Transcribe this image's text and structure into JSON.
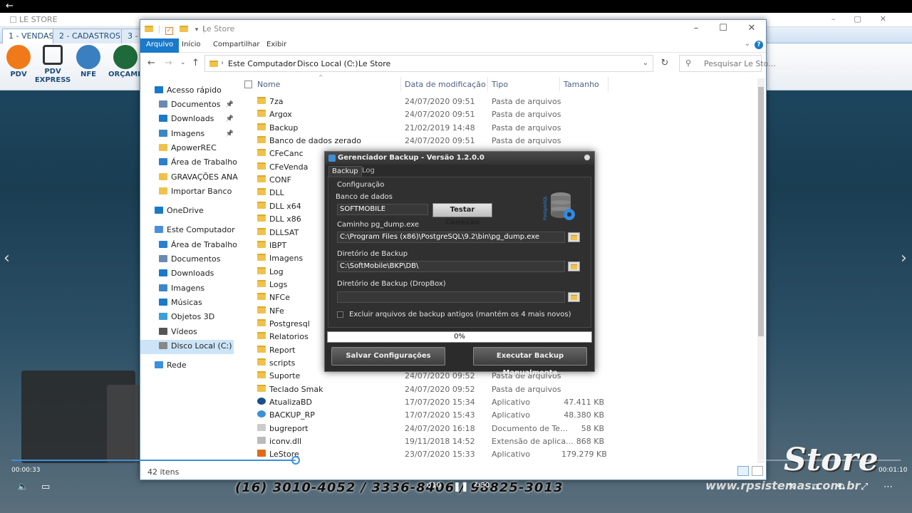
{
  "player": {
    "back_icon": "arrow-left-icon",
    "elapsed": "00:00:33",
    "remaining": "00:01:10",
    "progress_fraction": 0.32,
    "skip_back_label": "10",
    "skip_fwd_label": "30"
  },
  "app": {
    "title": "LE STORE",
    "tabs": [
      "1 - VENDAS",
      "2 - CADASTROS",
      "3 -"
    ],
    "ribbon": [
      {
        "label1": "PDV",
        "label2": "",
        "icon": "cart-add-icon"
      },
      {
        "label1": "PDV",
        "label2": "EXPRESS",
        "icon": "cart-arrow-icon"
      },
      {
        "label1": "NFE",
        "label2": "",
        "icon": "nfe-globe-icon"
      },
      {
        "label1": "ORÇAME",
        "label2": "",
        "icon": "budget-icon"
      }
    ],
    "phone": "(16) 3010-4052 / 3336-8406 / 98825-3013",
    "brand": "Store",
    "website": "www.rpsistemas.com.br"
  },
  "explorer": {
    "title": "Le Store",
    "ribbon_tabs": [
      "Arquivo",
      "Início",
      "Compartilhar",
      "Exibir"
    ],
    "breadcrumb": [
      "Este Computador",
      "Disco Local (C:)",
      "Le Store"
    ],
    "search_placeholder": "Pesquisar Le Sto...",
    "status": "42 itens",
    "columns": {
      "name": "Nome",
      "date": "Data de modificação",
      "type": "Tipo",
      "size": "Tamanho"
    },
    "nav": [
      {
        "label": "Acesso rápido",
        "icon": "star-icon",
        "level": 0,
        "pinned": false
      },
      {
        "label": "Documentos",
        "icon": "documents-icon",
        "level": 1,
        "pinned": true
      },
      {
        "label": "Downloads",
        "icon": "download-icon",
        "level": 1,
        "pinned": true
      },
      {
        "label": "Imagens",
        "icon": "pictures-icon",
        "level": 1,
        "pinned": true
      },
      {
        "label": "ApowerREC",
        "icon": "folder-icon",
        "level": 1,
        "pinned": false
      },
      {
        "label": "Área de Trabalho",
        "icon": "desktop-icon",
        "level": 1,
        "pinned": false
      },
      {
        "label": "GRAVAÇÕES ANA",
        "icon": "folder-icon",
        "level": 1,
        "pinned": false
      },
      {
        "label": "Importar Banco",
        "icon": "folder-icon",
        "level": 1,
        "pinned": false
      },
      {
        "label": "OneDrive",
        "icon": "cloud-icon",
        "level": 0,
        "pinned": false
      },
      {
        "label": "Este Computador",
        "icon": "computer-icon",
        "level": 0,
        "pinned": false
      },
      {
        "label": "Área de Trabalho",
        "icon": "desktop-icon",
        "level": 1,
        "pinned": false
      },
      {
        "label": "Documentos",
        "icon": "documents-icon",
        "level": 1,
        "pinned": false
      },
      {
        "label": "Downloads",
        "icon": "download-icon",
        "level": 1,
        "pinned": false
      },
      {
        "label": "Imagens",
        "icon": "pictures-icon",
        "level": 1,
        "pinned": false
      },
      {
        "label": "Músicas",
        "icon": "music-icon",
        "level": 1,
        "pinned": false
      },
      {
        "label": "Objetos 3D",
        "icon": "cube-icon",
        "level": 1,
        "pinned": false
      },
      {
        "label": "Vídeos",
        "icon": "video-icon",
        "level": 1,
        "pinned": false
      },
      {
        "label": "Disco Local (C:)",
        "icon": "drive-icon",
        "level": 1,
        "pinned": false
      },
      {
        "label": "Rede",
        "icon": "network-icon",
        "level": 0,
        "pinned": false
      }
    ],
    "files": [
      {
        "name": "7za",
        "date": "24/07/2020 09:51",
        "type": "Pasta de arquivos",
        "size": "",
        "icon": "folder-icon"
      },
      {
        "name": "Argox",
        "date": "24/07/2020 09:51",
        "type": "Pasta de arquivos",
        "size": "",
        "icon": "folder-icon"
      },
      {
        "name": "Backup",
        "date": "21/02/2019 14:48",
        "type": "Pasta de arquivos",
        "size": "",
        "icon": "folder-icon"
      },
      {
        "name": "Banco de dados zerado",
        "date": "24/07/2020 09:51",
        "type": "Pasta de arquivos",
        "size": "",
        "icon": "folder-icon"
      },
      {
        "name": "CFeCanc",
        "date": "",
        "type": "",
        "size": "",
        "icon": "folder-icon"
      },
      {
        "name": "CFeVenda",
        "date": "",
        "type": "",
        "size": "",
        "icon": "folder-icon"
      },
      {
        "name": "CONF",
        "date": "",
        "type": "",
        "size": "",
        "icon": "folder-icon"
      },
      {
        "name": "DLL",
        "date": "",
        "type": "",
        "size": "",
        "icon": "folder-icon"
      },
      {
        "name": "DLL x64",
        "date": "",
        "type": "",
        "size": "",
        "icon": "folder-icon"
      },
      {
        "name": "DLL x86",
        "date": "",
        "type": "",
        "size": "",
        "icon": "folder-icon"
      },
      {
        "name": "DLLSAT",
        "date": "",
        "type": "",
        "size": "",
        "icon": "folder-icon"
      },
      {
        "name": "IBPT",
        "date": "",
        "type": "",
        "size": "",
        "icon": "folder-icon"
      },
      {
        "name": "Imagens",
        "date": "",
        "type": "",
        "size": "",
        "icon": "folder-icon"
      },
      {
        "name": "Log",
        "date": "",
        "type": "",
        "size": "",
        "icon": "folder-icon"
      },
      {
        "name": "Logs",
        "date": "",
        "type": "",
        "size": "",
        "icon": "folder-icon"
      },
      {
        "name": "NFCe",
        "date": "",
        "type": "",
        "size": "",
        "icon": "folder-icon"
      },
      {
        "name": "NFe",
        "date": "",
        "type": "",
        "size": "",
        "icon": "folder-icon"
      },
      {
        "name": "Postgresql",
        "date": "",
        "type": "",
        "size": "",
        "icon": "folder-icon"
      },
      {
        "name": "Relatorios",
        "date": "",
        "type": "",
        "size": "",
        "icon": "folder-icon"
      },
      {
        "name": "Report",
        "date": "",
        "type": "",
        "size": "",
        "icon": "folder-icon"
      },
      {
        "name": "scripts",
        "date": "",
        "type": "",
        "size": "",
        "icon": "folder-icon"
      },
      {
        "name": "Suporte",
        "date": "24/07/2020 09:52",
        "type": "Pasta de arquivos",
        "size": "",
        "icon": "folder-icon"
      },
      {
        "name": "Teclado Smak",
        "date": "24/07/2020 09:52",
        "type": "Pasta de arquivos",
        "size": "",
        "icon": "folder-icon"
      },
      {
        "name": "AtualizaBD",
        "date": "17/07/2020 15:34",
        "type": "Aplicativo",
        "size": "47.411 KB",
        "icon": "app-update-icon"
      },
      {
        "name": "BACKUP_RP",
        "date": "17/07/2020 15:43",
        "type": "Aplicativo",
        "size": "48.380 KB",
        "icon": "database-icon"
      },
      {
        "name": "bugreport",
        "date": "24/07/2020 16:18",
        "type": "Documento de Te...",
        "size": "58 KB",
        "icon": "text-file-icon"
      },
      {
        "name": "iconv.dll",
        "date": "19/11/2018 14:52",
        "type": "Extensão de aplica...",
        "size": "868 KB",
        "icon": "dll-file-icon"
      },
      {
        "name": "LeStore",
        "date": "23/07/2020 15:33",
        "type": "Aplicativo",
        "size": "179.279 KB",
        "icon": "lestore-app-icon"
      }
    ]
  },
  "dialog": {
    "title": "Gerenciador Backup - Versão 1.2.0.0",
    "tabs": [
      "Backup",
      "Log"
    ],
    "group_label": "Configuração",
    "db_label": "Banco de dados",
    "db_value": "SOFTMOBILE",
    "test_button": "Testar Conexão",
    "logo_text": "PostgreSQL",
    "pgdump_label": "Caminho pg_dump.exe",
    "pgdump_value": "C:\\Program Files (x86)\\PostgreSQL\\9.2\\bin\\pg_dump.exe",
    "backup_dir_label": "Diretório de Backup",
    "backup_dir_value": "C:\\SoftMobile\\BKP\\DB\\",
    "dropbox_label": "Diretório de Backup (DropBox)",
    "dropbox_value": "",
    "exclude_label": "Excluir arquivos de backup antigos (mantém os 4 mais novos)",
    "progress_text": "0%",
    "save_button": "Salvar Configurações",
    "run_button": "Executar Backup Manualmente"
  },
  "colors": {
    "accent": "#1979ca",
    "folder": "#f0c24c",
    "dialog_bg": "#2b2b2b"
  }
}
